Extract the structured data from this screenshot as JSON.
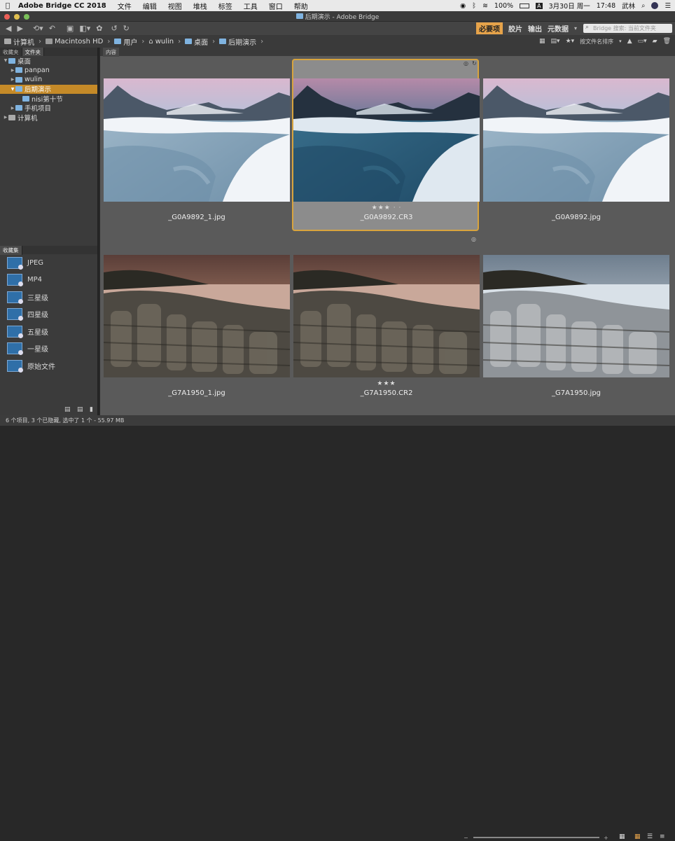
{
  "menubar": {
    "app": "Adobe Bridge CC 2018",
    "items": [
      "文件",
      "编辑",
      "视图",
      "堆栈",
      "标签",
      "工具",
      "窗口",
      "帮助"
    ],
    "battery": "100%",
    "date": "3月30日 周一",
    "time": "17:48",
    "user": "武林"
  },
  "window": {
    "title": "后期演示 - Adobe Bridge"
  },
  "toolbar": {
    "workspaces": [
      "必要项",
      "胶片",
      "输出",
      "元数据"
    ],
    "active_workspace": "必要项",
    "search_placeholder": "Bridge 搜索: 当前文件夹"
  },
  "path": [
    "计算机",
    "Macintosh HD",
    "用户",
    "wulin",
    "桌面",
    "后期演示"
  ],
  "left_panel": {
    "tabs": [
      "收藏夹",
      "文件夹"
    ],
    "active_tab": "文件夹",
    "tree": [
      {
        "label": "桌面",
        "level": 0,
        "expanded": true,
        "selected": false
      },
      {
        "label": "panpan",
        "level": 1,
        "expanded": false,
        "selected": false
      },
      {
        "label": "wulin",
        "level": 1,
        "expanded": false,
        "selected": false
      },
      {
        "label": "后期演示",
        "level": 1,
        "expanded": true,
        "selected": true
      },
      {
        "label": "nisi第十节",
        "level": 2,
        "expanded": false,
        "selected": false
      },
      {
        "label": "手机项目",
        "level": 1,
        "expanded": false,
        "selected": false
      },
      {
        "label": "计算机",
        "level": 0,
        "expanded": false,
        "selected": false
      }
    ],
    "collections_tab": "收藏集",
    "collections": [
      "JPEG",
      "MP4",
      "三星级",
      "四星级",
      "五星级",
      "一星级",
      "原始文件"
    ]
  },
  "content": {
    "tab": "内容",
    "sort_label": "按文件名排序",
    "thumbnails": [
      {
        "filename": "_G0A9892_1.jpg",
        "stars": "",
        "scene": "snow",
        "tone": "light"
      },
      {
        "filename": "_G0A9892.CR3",
        "stars": "★★★ · ·",
        "scene": "snow",
        "tone": "dark",
        "selected": true
      },
      {
        "filename": "_G0A9892.jpg",
        "stars": "",
        "scene": "snow",
        "tone": "light"
      },
      {
        "filename": "_G7A1950_1.jpg",
        "stars": "",
        "scene": "rocks",
        "tone": "warm"
      },
      {
        "filename": "_G7A1950.CR2",
        "stars": "★★★",
        "scene": "rocks",
        "tone": "warm"
      },
      {
        "filename": "_G7A1950.jpg",
        "stars": "",
        "scene": "rocks",
        "tone": "cool"
      }
    ]
  },
  "status": {
    "text": "6 个项目, 3 个已隐藏, 选中了 1 个 - 55.97 MB"
  }
}
